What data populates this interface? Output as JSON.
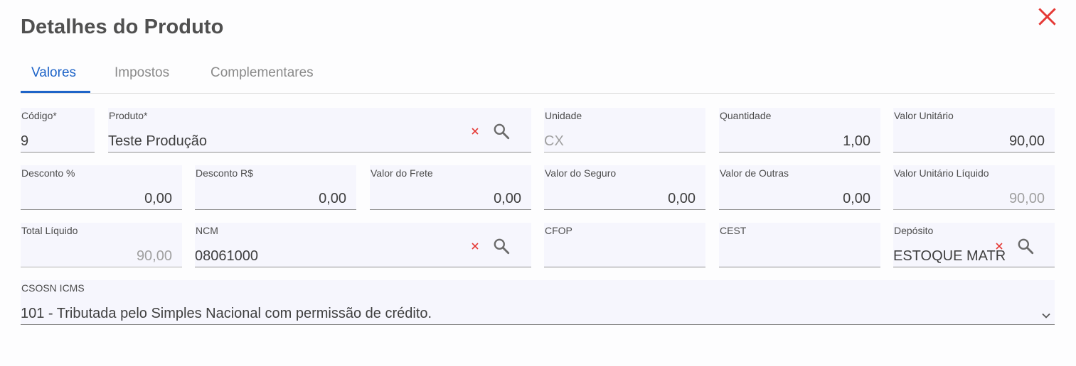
{
  "dialog": {
    "title": "Detalhes do Produto"
  },
  "tabs": [
    {
      "label": "Valores",
      "active": true
    },
    {
      "label": "Impostos",
      "active": false
    },
    {
      "label": "Complementares",
      "active": false
    }
  ],
  "fields": {
    "codigo": {
      "label": "Código*",
      "value": "9"
    },
    "produto": {
      "label": "Produto*",
      "value": "Teste Produção"
    },
    "unidade": {
      "label": "Unidade",
      "value": "CX"
    },
    "quantidade": {
      "label": "Quantidade",
      "value": "1,00"
    },
    "valor_unitario": {
      "label": "Valor Unitário",
      "value": "90,00"
    },
    "desconto_pct": {
      "label": "Desconto %",
      "value": "0,00"
    },
    "desconto_rs": {
      "label": "Desconto R$",
      "value": "0,00"
    },
    "valor_frete": {
      "label": "Valor do Frete",
      "value": "0,00"
    },
    "valor_seguro": {
      "label": "Valor do Seguro",
      "value": "0,00"
    },
    "valor_outras": {
      "label": "Valor de Outras",
      "value": "0,00"
    },
    "valor_unitario_liquido": {
      "label": "Valor Unitário Líquido",
      "value": "90,00"
    },
    "total_liquido": {
      "label": "Total Líquido",
      "value": "90,00"
    },
    "ncm": {
      "label": "NCM",
      "value": "08061000"
    },
    "cfop": {
      "label": "CFOP",
      "value": ""
    },
    "cest": {
      "label": "CEST",
      "value": ""
    },
    "deposito": {
      "label": "Depósito",
      "value": "ESTOQUE MATRIZ"
    },
    "csosn_icms": {
      "label": "CSOSN ICMS",
      "value": "101 - Tributada pelo Simples Nacional com permissão de crédito."
    }
  },
  "icons": {
    "close": "close-icon",
    "clear": "clear-x-icon",
    "search": "search-icon",
    "dropdown": "chevron-down-icon"
  },
  "colors": {
    "accent": "#1e64c8",
    "close": "#e53935",
    "clear": "#e53935",
    "field_bg": "#f6f6fd"
  }
}
